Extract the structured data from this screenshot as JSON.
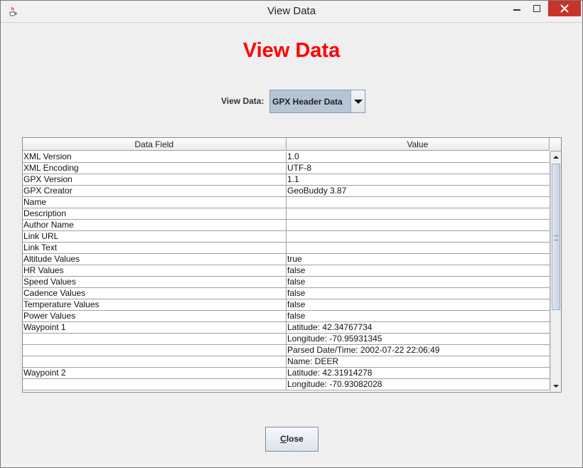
{
  "window": {
    "title": "View Data",
    "icon": "java-cup-icon"
  },
  "heading": "View Data",
  "selector": {
    "label": "View Data:",
    "value": "GPX Header Data"
  },
  "table": {
    "columns": [
      "Data Field",
      "Value"
    ],
    "rows": [
      [
        "XML Version",
        "1.0"
      ],
      [
        "XML Encoding",
        "UTF-8"
      ],
      [
        "GPX Version",
        "1.1"
      ],
      [
        "GPX Creator",
        "GeoBuddy 3.87"
      ],
      [
        "Name",
        ""
      ],
      [
        "Description",
        ""
      ],
      [
        "Author Name",
        ""
      ],
      [
        "Link URL",
        ""
      ],
      [
        "Link Text",
        ""
      ],
      [
        "Altitude Values",
        "true"
      ],
      [
        "HR Values",
        "false"
      ],
      [
        "Speed Values",
        "false"
      ],
      [
        "Cadence Values",
        "false"
      ],
      [
        "Temperature Values",
        "false"
      ],
      [
        "Power Values",
        "false"
      ],
      [
        "Waypoint 1",
        "Latitude: 42.34767734"
      ],
      [
        "",
        "Longitude: -70.95931345"
      ],
      [
        "",
        "Parsed Date/Time: 2002-07-22 22:06:49"
      ],
      [
        "",
        "Name: DEER"
      ],
      [
        "Waypoint 2",
        "Latitude: 42.31914278"
      ],
      [
        "",
        "Longitude: -70.93082028"
      ]
    ]
  },
  "buttons": {
    "close_mnemonic": "C",
    "close_rest": "lose"
  },
  "colors": {
    "heading": "#ff0000",
    "close_control": "#c7342b"
  }
}
